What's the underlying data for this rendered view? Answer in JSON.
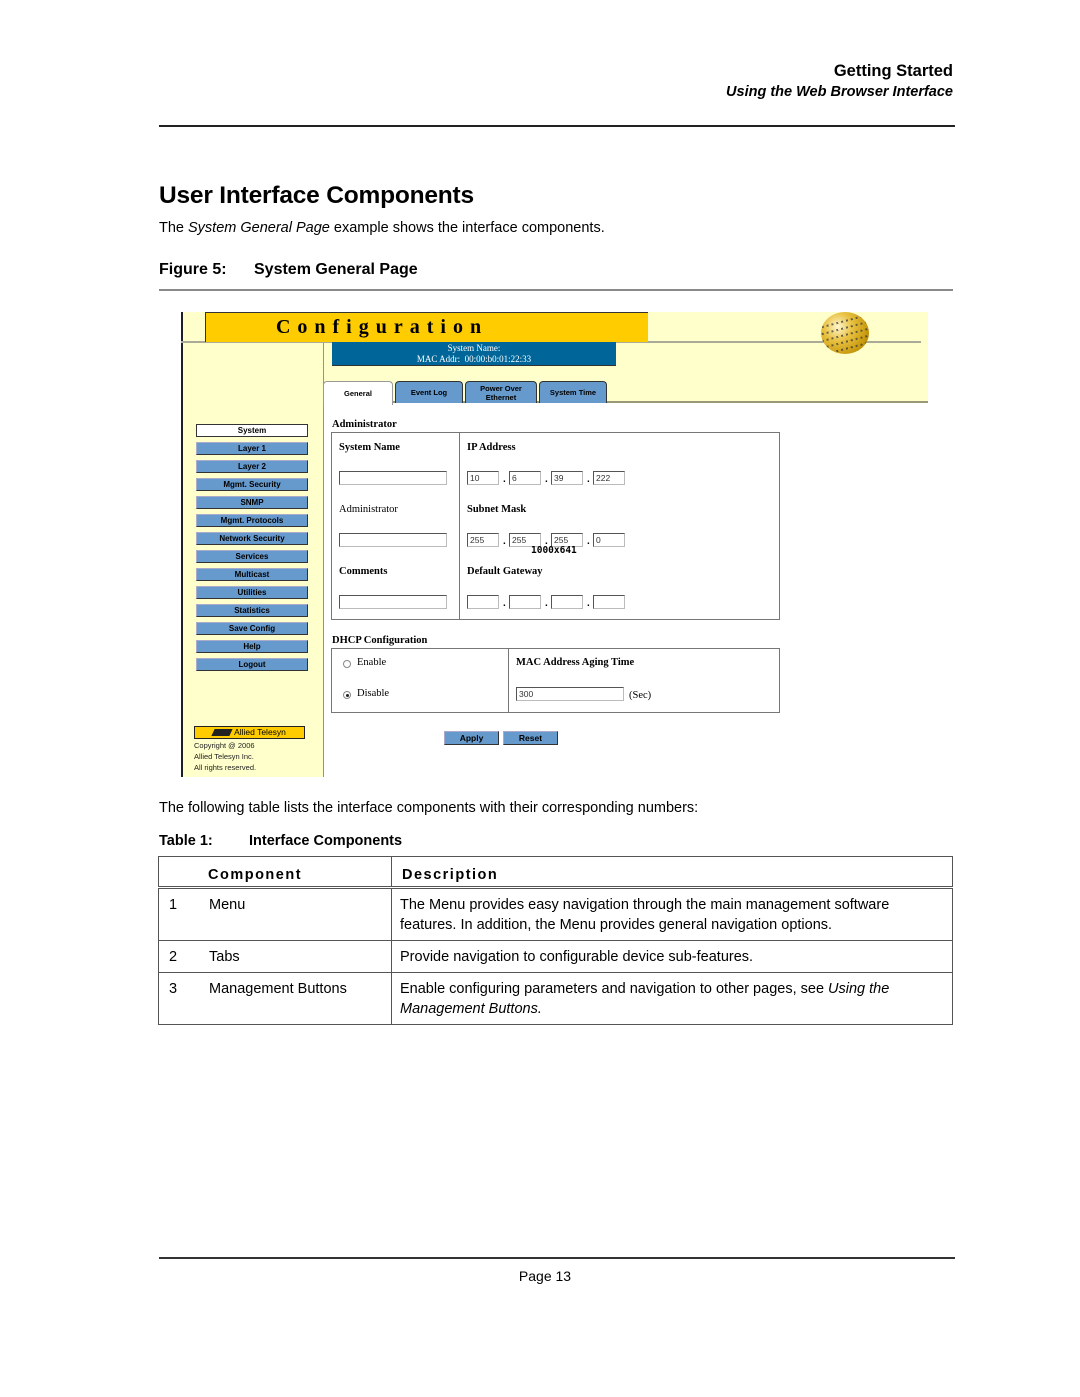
{
  "header": {
    "chapter": "Getting Started",
    "section": "Using the Web Browser Interface"
  },
  "heading": "User Interface Components",
  "intro": {
    "before": "The ",
    "italic": "System General Page",
    "after": " example shows the interface components."
  },
  "figure": {
    "number": "Figure 5:",
    "title": "System General Page"
  },
  "screenshot": {
    "title": "Configuration",
    "system_name_label": "System Name:",
    "mac_label": "MAC Addr:",
    "mac_value": "00:00:b0:01:22:33",
    "tabs": [
      {
        "label": "General",
        "active": true
      },
      {
        "label": "Event Log",
        "active": false
      },
      {
        "label": "Power Over Ethernet",
        "active": false
      },
      {
        "label": "System Time",
        "active": false
      }
    ],
    "menu": [
      {
        "label": "System",
        "active": true
      },
      {
        "label": "Layer 1"
      },
      {
        "label": "Layer 2"
      },
      {
        "label": "Mgmt. Security"
      },
      {
        "label": "SNMP"
      },
      {
        "label": "Mgmt. Protocols"
      },
      {
        "label": "Network Security"
      },
      {
        "label": "Services"
      },
      {
        "label": "Multicast"
      },
      {
        "label": "Utilities"
      },
      {
        "label": "Statistics"
      },
      {
        "label": "Save Config"
      },
      {
        "label": "Help"
      },
      {
        "label": "Logout"
      }
    ],
    "brand": "Allied Telesyn",
    "copyright": [
      "Copyright @ 2006",
      "Allied Telesyn Inc.",
      "All rights reserved."
    ],
    "admin_section": "Administrator",
    "fields": {
      "system_name": {
        "label": "System Name",
        "value": ""
      },
      "administrator": {
        "label": "Administrator",
        "value": ""
      },
      "comments": {
        "label": "Comments",
        "value": ""
      },
      "ip_address": {
        "label": "IP Address",
        "octets": [
          "10",
          "6",
          "39",
          "222"
        ]
      },
      "subnet_mask": {
        "label": "Subnet Mask",
        "octets": [
          "255",
          "255",
          "255",
          "0"
        ]
      },
      "default_gateway": {
        "label": "Default Gateway",
        "octets": [
          "",
          "",
          "",
          ""
        ]
      }
    },
    "resolution_overlay": "1000x641",
    "dhcp_section": "DHCP Configuration",
    "dhcp": {
      "enable_label": "Enable",
      "disable_label": "Disable",
      "selected": "Disable"
    },
    "mac_aging": {
      "label": "MAC Address Aging Time",
      "value": "300",
      "unit": "(Sec)"
    },
    "buttons": {
      "apply": "Apply",
      "reset": "Reset"
    }
  },
  "after_text": "The following table lists the interface components with their corresponding numbers:",
  "table": {
    "number": "Table 1:",
    "title": "Interface Components",
    "headers": [
      "Component",
      "Description"
    ],
    "rows": [
      {
        "num": "1",
        "component": "Menu",
        "description": "The Menu provides easy navigation through the main management software features. In addition, the Menu provides general navigation options.",
        "desc_italic": ""
      },
      {
        "num": "2",
        "component": "Tabs",
        "description": "Provide navigation to configurable device sub-features.",
        "desc_italic": ""
      },
      {
        "num": "3",
        "component": "Management Buttons",
        "description": "Enable configuring parameters and navigation to other pages, see ",
        "desc_italic": "Using the Management Buttons."
      }
    ]
  },
  "footer": {
    "page": "Page 13"
  },
  "colors": {
    "title_bar": "#ffcc00",
    "pane_bg": "#ffffcc",
    "menu_button": "#6699cc",
    "system_box": "#006699"
  }
}
